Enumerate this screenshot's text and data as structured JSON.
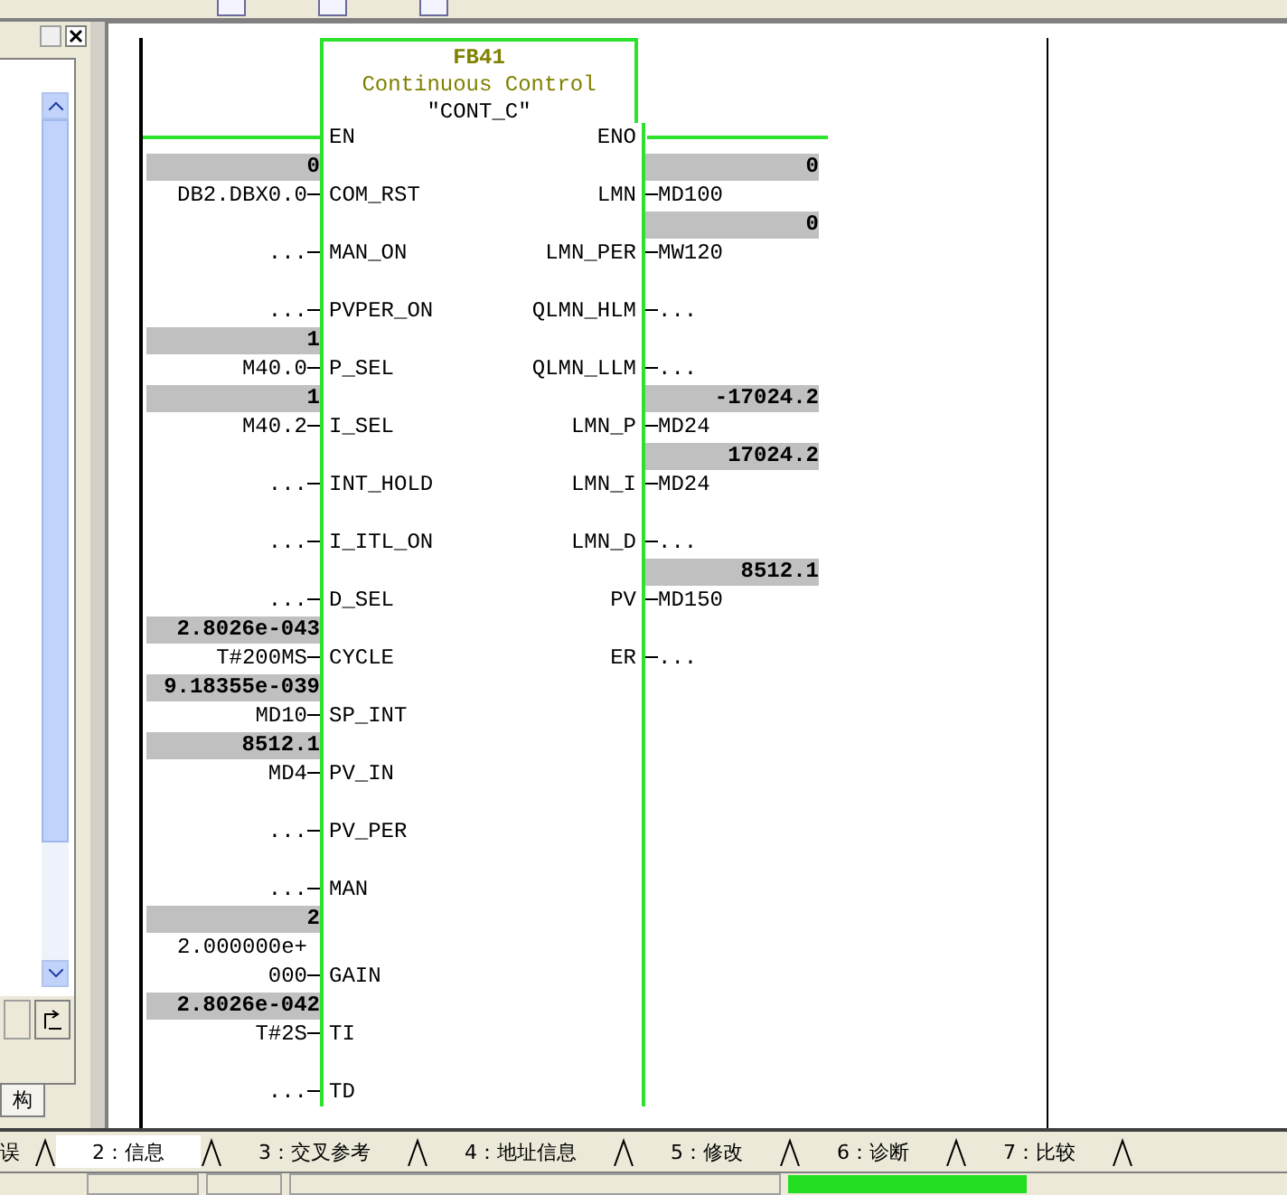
{
  "block": {
    "number": "FB41",
    "comment": "Continuous Control",
    "symbol": "″CONT_C″",
    "enable_in": "EN",
    "enable_out": "ENO"
  },
  "pins": [
    {
      "input": {
        "name": "COM_RST",
        "address": "DB2.DBX0.0",
        "value": "0"
      },
      "output": {
        "name": "LMN",
        "address": "MD100",
        "value": "0"
      }
    },
    {
      "input": {
        "name": "MAN_ON",
        "address": "..."
      },
      "output": {
        "name": "LMN_PER",
        "address": "MW120",
        "value": "0"
      }
    },
    {
      "input": {
        "name": "PVPER_ON",
        "address": "..."
      },
      "output": {
        "name": "QLMN_HLM",
        "address": "..."
      }
    },
    {
      "input": {
        "name": "P_SEL",
        "address": "M40.0",
        "value": "1"
      },
      "output": {
        "name": "QLMN_LLM",
        "address": "..."
      }
    },
    {
      "input": {
        "name": "I_SEL",
        "address": "M40.2",
        "value": "1"
      },
      "output": {
        "name": "LMN_P",
        "address": "MD24",
        "value": "-17024.2"
      }
    },
    {
      "input": {
        "name": "INT_HOLD",
        "address": "..."
      },
      "output": {
        "name": "LMN_I",
        "address": "MD24",
        "value": "17024.2"
      }
    },
    {
      "input": {
        "name": "I_ITL_ON",
        "address": "..."
      },
      "output": {
        "name": "LMN_D",
        "address": "..."
      }
    },
    {
      "input": {
        "name": "D_SEL",
        "address": "..."
      },
      "output": {
        "name": "PV",
        "address": "MD150",
        "value": "8512.1"
      }
    },
    {
      "input": {
        "name": "CYCLE",
        "address": "T#200MS",
        "value": "2.8026e-043"
      },
      "output": {
        "name": "ER",
        "address": "..."
      }
    },
    {
      "input": {
        "name": "SP_INT",
        "address": "MD10",
        "value": "9.18355e-039"
      }
    },
    {
      "input": {
        "name": "PV_IN",
        "address": "MD4",
        "value": "8512.1"
      }
    },
    {
      "input": {
        "name": "PV_PER",
        "address": "..."
      }
    },
    {
      "input": {
        "name": "MAN",
        "address": "..."
      }
    },
    {
      "input": {
        "name": "GAIN",
        "address": "2.000000e+000",
        "value": "2"
      }
    },
    {
      "input": {
        "name": "TI",
        "address": "T#2S",
        "value": "2.8026e-042"
      }
    },
    {
      "input": {
        "name": "TD",
        "address": "..."
      }
    }
  ],
  "sidebar": {
    "tabs": [
      {
        "label": "构",
        "selected": true
      }
    ]
  },
  "bottom_tabs": [
    {
      "label": "误",
      "selected": false
    },
    {
      "label": "2：信息",
      "selected": true
    },
    {
      "label": "3：交叉参考",
      "selected": false
    },
    {
      "label": "4：地址信息",
      "selected": false
    },
    {
      "label": "5：修改",
      "selected": false
    },
    {
      "label": "6：诊断",
      "selected": false
    },
    {
      "label": "7：比较",
      "selected": false
    }
  ]
}
